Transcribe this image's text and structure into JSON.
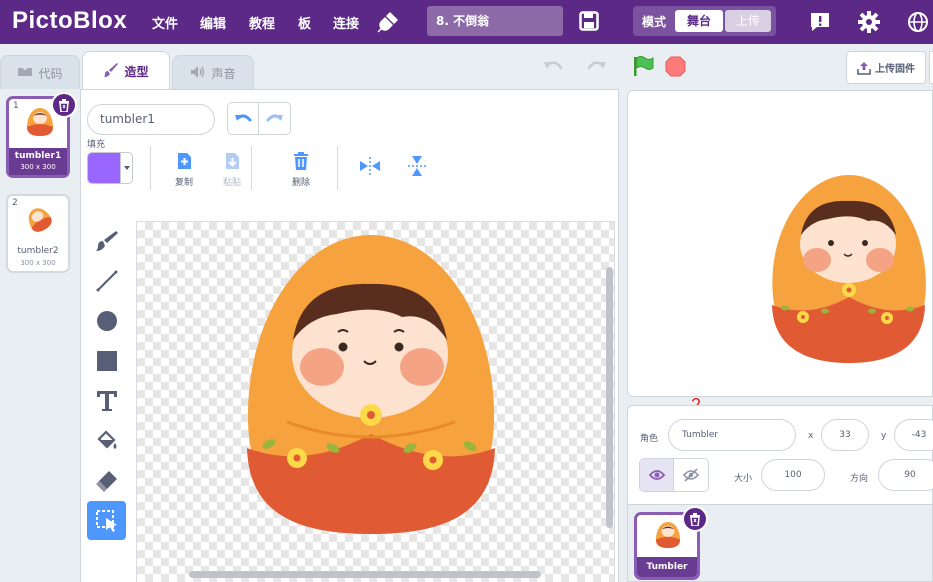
{
  "app": {
    "logo": "PictoBlox",
    "menu": [
      "文件",
      "编辑",
      "教程",
      "板",
      "连接"
    ],
    "project_title": "8. 不倒翁",
    "mode_label": "模式",
    "mode_stage": "舞台",
    "mode_upload": "上传"
  },
  "tabs": {
    "code": "代码",
    "costumes": "造型",
    "sounds": "声音"
  },
  "costumes": [
    {
      "index": "1",
      "name": "tumbler1",
      "size": "300 x 300"
    },
    {
      "index": "2",
      "name": "tumbler2",
      "size": "300 x 300"
    }
  ],
  "editor": {
    "costume_name": "tumbler1",
    "fill_label": "填充",
    "fill_color": "#9966ff",
    "copy_label": "复制",
    "paste_label": "粘贴",
    "delete_label": "删除"
  },
  "right_panel": {
    "upload_firmware": "上传固件",
    "sprite_label": "角色",
    "sprite_name": "Tumbler",
    "x_label": "x",
    "x_value": "33",
    "y_label": "y",
    "y_value": "-43",
    "size_label": "大小",
    "size_value": "100",
    "direction_label": "方向",
    "direction_value": "90",
    "sprite_tile_name": "Tumbler"
  },
  "annotations": [
    "1",
    "2"
  ],
  "colors": {
    "menubar": "#5c2a86",
    "accent": "#8a5cb3",
    "tool_active": "#4d97ff",
    "tumbler_orange": "#f6a23e",
    "tumbler_red": "#e05a33"
  }
}
